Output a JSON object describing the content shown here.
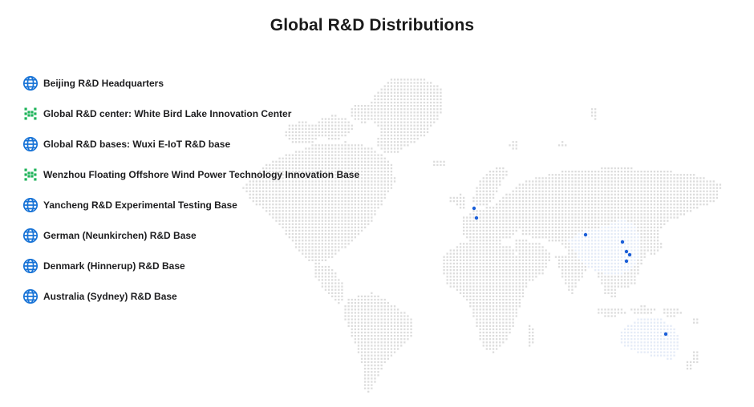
{
  "page": {
    "title": "Global R&D Distributions"
  },
  "colors": {
    "globe_blue": "#1672d6",
    "lattice_green": "#1fb35a",
    "map_dot": "#dcdcdc",
    "region_highlight": "#e4ebf7",
    "marker": "#1a5ed8"
  },
  "legend": {
    "items": [
      {
        "label": "Beijing R&D Headquarters",
        "icon": "globe-icon"
      },
      {
        "label": "Global R&D center: White Bird Lake Innovation Center",
        "icon": "lattice-icon"
      },
      {
        "label": "Global R&D bases: Wuxi E-IoT R&D base",
        "icon": "globe-icon"
      },
      {
        "label": "Wenzhou Floating Offshore Wind Power Technology Innovation Base",
        "icon": "lattice-icon"
      },
      {
        "label": "Yancheng R&D Experimental Testing Base",
        "icon": "globe-icon"
      },
      {
        "label": "German (Neunkirchen) R&D Base",
        "icon": "globe-icon"
      },
      {
        "label": "Denmark (Hinnerup) R&D Base",
        "icon": "globe-icon"
      },
      {
        "label": "Australia (Sydney) R&D Base",
        "icon": "globe-icon"
      }
    ]
  }
}
